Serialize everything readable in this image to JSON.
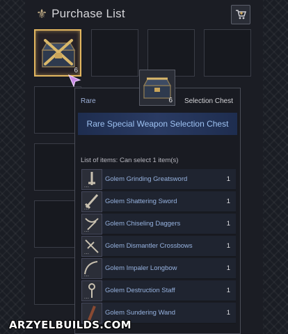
{
  "header": {
    "title": "Purchase List",
    "emblem_icon": "fleur-de-lis-icon",
    "cart_icon": "cart-icon"
  },
  "selected_slot": {
    "count": "6"
  },
  "tooltip": {
    "grade": "Rare",
    "type": "Selection Chest",
    "name": "Rare Special Weapon Selection Chest",
    "icon_count": "6",
    "list_label": "List of items: Can select 1 item(s)",
    "items": [
      {
        "name": "Golem Grinding Greatsword",
        "qty": "1",
        "icon": "greatsword-icon"
      },
      {
        "name": "Golem Shattering Sword",
        "qty": "1",
        "icon": "sword-icon"
      },
      {
        "name": "Golem Chiseling Daggers",
        "qty": "1",
        "icon": "daggers-icon"
      },
      {
        "name": "Golem Dismantler Crossbows",
        "qty": "1",
        "icon": "crossbow-icon"
      },
      {
        "name": "Golem Impaler Longbow",
        "qty": "1",
        "icon": "longbow-icon"
      },
      {
        "name": "Golem Destruction Staff",
        "qty": "1",
        "icon": "staff-icon"
      },
      {
        "name": "Golem Sundering Wand",
        "qty": "1",
        "icon": "wand-icon"
      }
    ],
    "item_dots": "..."
  },
  "watermark": "ARZYELBUILDS.COM",
  "colors": {
    "selected_border": "#e3b760",
    "rare_name": "#9ec2f2",
    "item_name": "#97b3e0"
  }
}
